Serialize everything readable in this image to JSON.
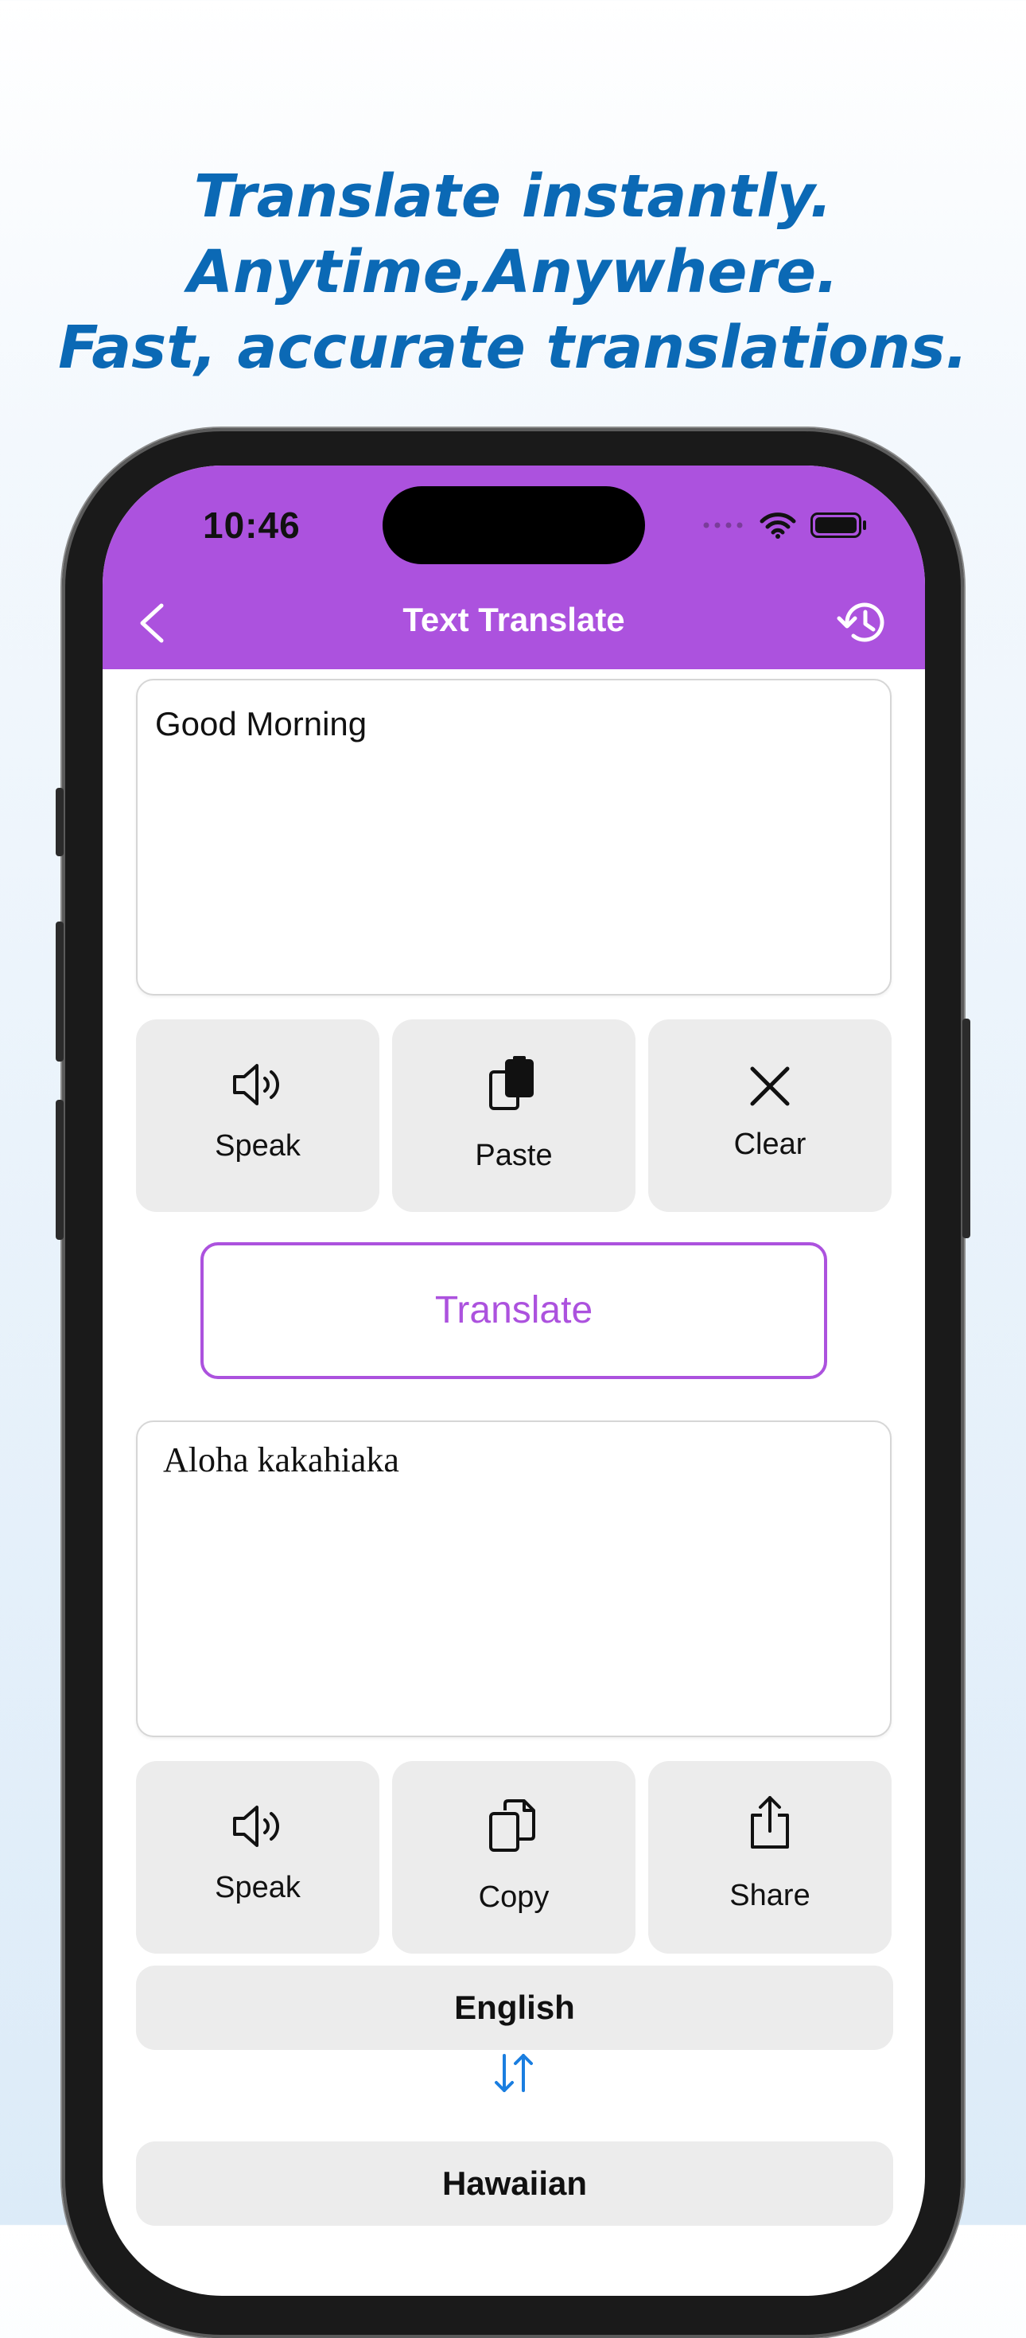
{
  "promo": {
    "line1": "Translate instantly.",
    "line2": "Anytime,Anywhere.",
    "line3": "Fast, accurate translations."
  },
  "status": {
    "time": "10:46"
  },
  "nav": {
    "title": "Text Translate"
  },
  "input": {
    "text": "Good Morning"
  },
  "input_actions": {
    "speak_label": "Speak",
    "paste_label": "Paste",
    "clear_label": "Clear"
  },
  "translate": {
    "button_label": "Translate"
  },
  "output": {
    "text": "Aloha kakahiaka"
  },
  "output_actions": {
    "speak_label": "Speak",
    "copy_label": "Copy",
    "share_label": "Share"
  },
  "languages": {
    "source": "English",
    "target": "Hawaiian"
  },
  "colors": {
    "accent": "#ac52de",
    "headline": "#0b69b5",
    "swap_icon": "#1a7ee0"
  }
}
